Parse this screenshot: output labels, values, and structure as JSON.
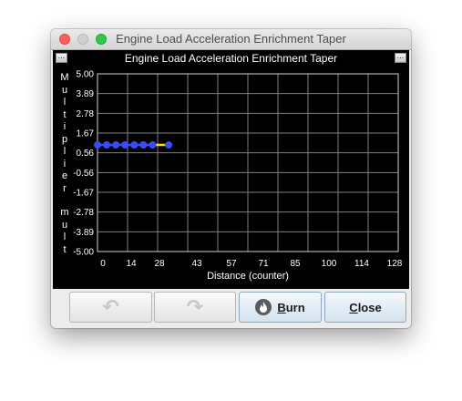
{
  "window": {
    "title": "Engine Load Acceleration Enrichment Taper"
  },
  "chart_panel": {
    "left_button": "...",
    "right_button": "...",
    "y_axis_letters_top": [
      "M",
      "u",
      "l",
      "t",
      "i",
      "p",
      "l",
      "i",
      "e",
      "r"
    ],
    "y_axis_letters_bottom": [
      "m",
      "u",
      "l",
      "t"
    ]
  },
  "chart_data": {
    "type": "line",
    "title": "Engine Load Acceleration Enrichment Taper",
    "xlabel": "Distance (counter)",
    "ylabel": "Multiplier mult",
    "x_ticks": [
      "0",
      "14",
      "28",
      "43",
      "57",
      "71",
      "85",
      "100",
      "114",
      "128"
    ],
    "y_ticks": [
      "5.00",
      "3.89",
      "2.78",
      "1.67",
      "0.56",
      "-0.56",
      "-1.67",
      "-2.78",
      "-3.89",
      "-5.00"
    ],
    "xlim": [
      -3,
      128
    ],
    "ylim": [
      -5.0,
      5.0
    ],
    "grid": true,
    "series": [
      {
        "x": [
          -3,
          1,
          5,
          9,
          13,
          17,
          21,
          28
        ],
        "y": [
          1.0,
          1.0,
          1.0,
          1.0,
          1.0,
          1.0,
          1.0,
          1.0
        ],
        "point_color": "#3a4cf5",
        "line_color": "#ffe000",
        "highlight_segment_from": 6
      }
    ]
  },
  "buttons": {
    "undo_icon": "undo-arrow-icon",
    "redo_icon": "redo-arrow-icon",
    "burn_icon": "flame-icon",
    "burn_mnemonic": "B",
    "burn_rest": "urn",
    "close_mnemonic": "C",
    "close_rest": "lose"
  }
}
